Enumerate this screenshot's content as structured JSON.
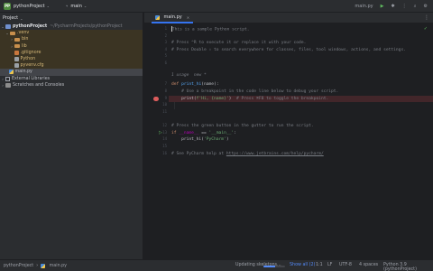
{
  "titlebar": {
    "badge": "PP",
    "project": "pythonProject",
    "branch": "main"
  },
  "sidebar": {
    "header": "Project",
    "root_name": "pythonProject",
    "root_path": "~/PycharmProjects/pythonProject",
    "items": {
      "venv": ".venv",
      "bin": "bin",
      "lib": "lib",
      "gitignore": ".gitignore",
      "python": "Python",
      "pyvenv": "pyvenv.cfg",
      "main": "main.py",
      "external": "External Libraries",
      "scratches": "Scratches and Consoles"
    }
  },
  "editor": {
    "tab": "main.py",
    "line_numbers": [
      "1",
      "2",
      "3",
      "4",
      "5",
      "6",
      "7",
      "8",
      "9",
      "10",
      "11",
      "12",
      "13",
      "14",
      "15",
      "16"
    ],
    "code": {
      "l1": "This is a sample Python script.",
      "l3": "# Press ^R to execute it or replace it with your code.",
      "l4": "# Press Double ⇧ to search everywhere for classes, files, tool windows, actions, and settings.",
      "usage": "1 usage  new *",
      "l7_kw": "def",
      "l7_fn": "print_hi",
      "l7_rest": "(name):",
      "l8": "    # Use a breakpoint in the code line below to debug your script.",
      "l9_call": "    print(",
      "l9_str": "f'Hi, {name}'",
      "l9_close": ")",
      "l9_cmt": "  # Press ⌘F8 to toggle the breakpoint.",
      "l12": "# Press the green button in the gutter to run the script.",
      "l13_kw": "if",
      "l13_name": " __name__",
      "l13_eq": " == ",
      "l13_str": "'__main__'",
      "l13_colon": ":",
      "l14_call": "    print_hi(",
      "l14_str": "'PyCharm'",
      "l14_close": ")",
      "l16_prefix": "# See PyCharm help at ",
      "l16_link": "https://www.jetbrains.com/help/pycharm/"
    }
  },
  "statusbar": {
    "crumb_root": "pythonProject",
    "crumb_file": "main.py",
    "progress_text": "Updating skeletons...",
    "progress_value": 0.55,
    "show_all": "Show all (2)",
    "position": "1:1",
    "line_sep": "LF",
    "encoding": "UTF-8",
    "indent": "4 spaces",
    "interpreter": "Python 3.9 (pythonProject)"
  }
}
